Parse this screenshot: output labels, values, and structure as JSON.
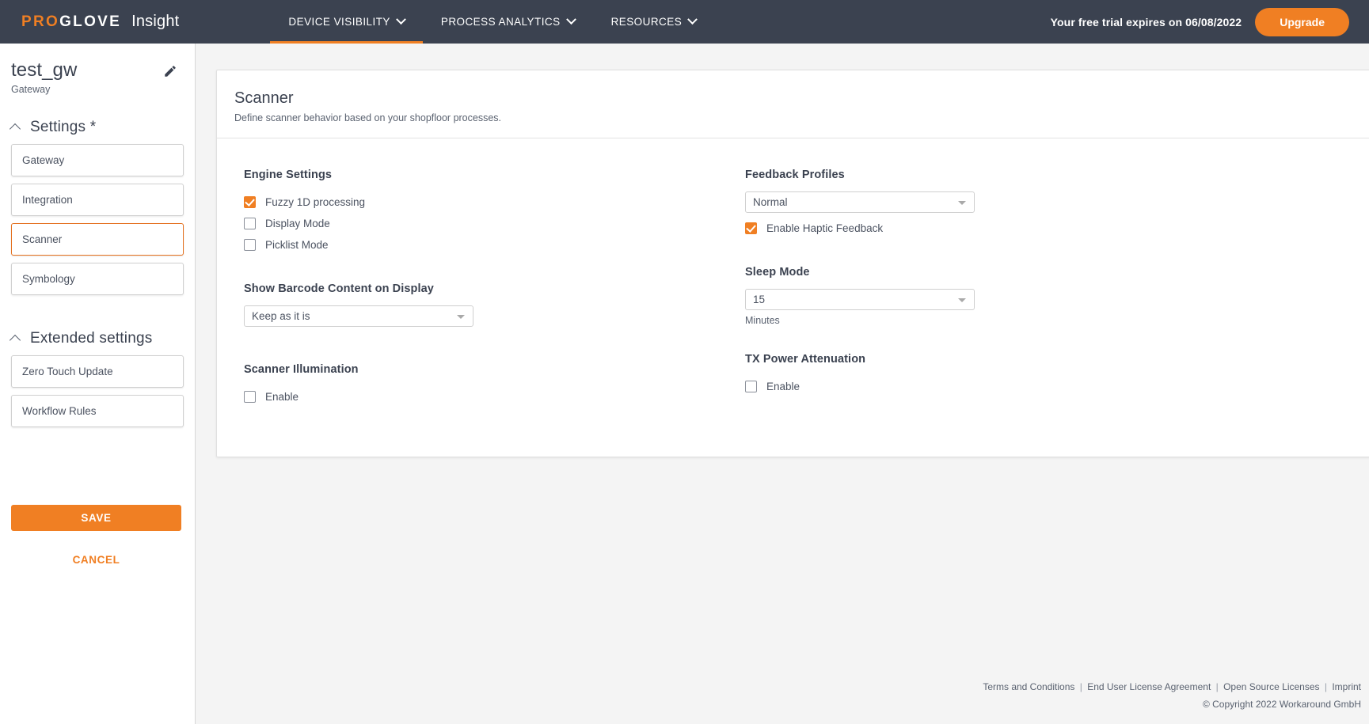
{
  "header": {
    "brand_pro": "PRO",
    "brand_glove": "GLOVE",
    "brand_product": "Insight",
    "nav": [
      {
        "label": "DEVICE VISIBILITY",
        "active": true
      },
      {
        "label": "PROCESS ANALYTICS",
        "active": false
      },
      {
        "label": "RESOURCES",
        "active": false
      }
    ],
    "trial_notice": "Your free trial expires on 06/08/2022",
    "upgrade_label": "Upgrade"
  },
  "sidebar": {
    "device_name": "test_gw",
    "device_type": "Gateway",
    "edit_icon": "pencil-icon",
    "settings_section": {
      "title": "Settings *",
      "collapse_icon": "chevron-up-icon",
      "items": [
        {
          "label": "Gateway",
          "selected": false
        },
        {
          "label": "Integration",
          "selected": false
        },
        {
          "label": "Scanner",
          "selected": true
        },
        {
          "label": "Symbology",
          "selected": false
        }
      ]
    },
    "extended_section": {
      "title": "Extended settings",
      "collapse_icon": "chevron-up-icon",
      "items": [
        {
          "label": "Zero Touch Update",
          "selected": false
        },
        {
          "label": "Workflow Rules",
          "selected": false
        }
      ]
    },
    "save_label": "SAVE",
    "cancel_label": "CANCEL"
  },
  "main": {
    "title": "Scanner",
    "subtitle": "Define scanner behavior based on your shopfloor processes.",
    "engine_settings": {
      "title": "Engine Settings",
      "options": [
        {
          "label": "Fuzzy 1D processing",
          "checked": true
        },
        {
          "label": "Display Mode",
          "checked": false
        },
        {
          "label": "Picklist Mode",
          "checked": false
        }
      ]
    },
    "barcode_display": {
      "title": "Show Barcode Content on Display",
      "value": "Keep as it is"
    },
    "scanner_illumination": {
      "title": "Scanner Illumination",
      "options": [
        {
          "label": "Enable",
          "checked": false
        }
      ]
    },
    "feedback_profiles": {
      "title": "Feedback Profiles",
      "value": "Normal",
      "options": [
        {
          "label": "Enable Haptic Feedback",
          "checked": true
        }
      ]
    },
    "sleep_mode": {
      "title": "Sleep Mode",
      "value": "15",
      "unit": "Minutes"
    },
    "tx_power": {
      "title": "TX Power Attenuation",
      "options": [
        {
          "label": "Enable",
          "checked": false
        }
      ]
    }
  },
  "footer": {
    "links": [
      "Terms and Conditions",
      "End User License Agreement",
      "Open Source Licenses",
      "Imprint"
    ],
    "separator": "|",
    "copyright": "© Copyright 2022 Workaround GmbH"
  },
  "colors": {
    "accent": "#f07f23",
    "navbar": "#3b4250",
    "page_bg": "#f4f4f4"
  }
}
